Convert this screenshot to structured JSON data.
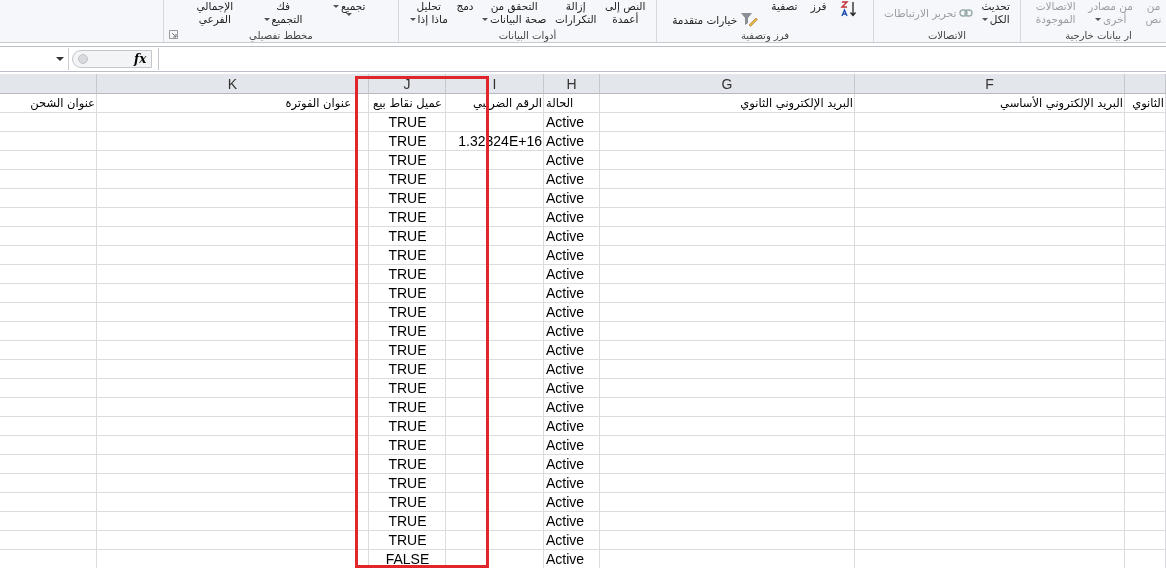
{
  "ribbon": {
    "groups": [
      {
        "label": "ار بيانات خارجية",
        "buttons": [
          {
            "kind": "large",
            "lines": [
              "من",
              "نص"
            ],
            "disabled": true,
            "dropdown": false
          },
          {
            "kind": "large",
            "lines": [
              "من مصادر",
              "أخرى"
            ],
            "disabled": true,
            "dropdown": true
          },
          {
            "kind": "large",
            "lines": [
              "الاتصالات",
              "الموجودة"
            ],
            "disabled": true,
            "dropdown": false
          }
        ]
      },
      {
        "label": "الاتصالات",
        "buttons": [
          {
            "kind": "large",
            "lines": [
              "تحديث",
              "الكل"
            ],
            "disabled": false,
            "dropdown": true
          },
          {
            "kind": "small",
            "lines": [
              "تحرير الارتباطات"
            ],
            "disabled": true,
            "dropdown": false
          }
        ]
      },
      {
        "label": "فرز وتصفية",
        "buttons": [
          {
            "kind": "icon"
          },
          {
            "kind": "large",
            "lines": [
              "فرز"
            ],
            "disabled": false,
            "dropdown": false
          },
          {
            "kind": "large",
            "lines": [
              "تصفية"
            ],
            "disabled": false,
            "dropdown": false
          },
          {
            "kind": "small",
            "lines": [
              "خيارات متقدمة"
            ],
            "disabled": false,
            "dropdown": false
          }
        ]
      },
      {
        "label": "أدوات البيانات",
        "buttons": [
          {
            "kind": "large",
            "lines": [
              "النص إلى",
              "أعمدة"
            ],
            "disabled": false,
            "dropdown": false
          },
          {
            "kind": "large",
            "lines": [
              "إزالة",
              "التكرارات"
            ],
            "disabled": false,
            "dropdown": false
          },
          {
            "kind": "large",
            "lines": [
              "التحقق من",
              "صحة البيانات"
            ],
            "disabled": false,
            "dropdown": true
          },
          {
            "kind": "large",
            "lines": [
              "دمج"
            ],
            "disabled": false,
            "dropdown": false
          },
          {
            "kind": "large",
            "lines": [
              "تحليل",
              "ماذا إذا"
            ],
            "disabled": false,
            "dropdown": true
          }
        ]
      },
      {
        "label": "مخطط تفصيلي",
        "buttons": [
          {
            "kind": "large",
            "lines": [
              "تجميع"
            ],
            "disabled": false,
            "dropdown": true
          },
          {
            "kind": "large",
            "lines": [
              "فك",
              "التجميع"
            ],
            "disabled": false,
            "dropdown": true
          },
          {
            "kind": "large",
            "lines": [
              "الإجمالي",
              "الفرعي"
            ],
            "disabled": false,
            "dropdown": false
          }
        ]
      }
    ]
  },
  "formula_bar": {
    "function_label": "fx"
  },
  "column_headers": [
    {
      "letter": "F"
    },
    {
      "letter": "G"
    },
    {
      "letter": "H"
    },
    {
      "letter": "I"
    },
    {
      "letter": "J"
    },
    {
      "letter": "K"
    }
  ],
  "rows": [
    {
      "column_1": "الثانوي",
      "column_2": "البريد الإلكتروني الأساسي",
      "column_3": "البريد الإلكتروني الثانوي",
      "column_4": "الحالة",
      "column_5": "الرقم الضريبي",
      "column_6": "عميل نقاط بيع",
      "column_7": "عنوان الفوترة",
      "column_8": "عنوان الشحن"
    },
    {
      "column_4": "Active",
      "column_6": "TRUE"
    },
    {
      "column_4": "Active",
      "column_5": "1.32324E+16",
      "column_6": "TRUE"
    },
    {
      "column_4": "Active",
      "column_6": "TRUE"
    },
    {
      "column_4": "Active",
      "column_6": "TRUE"
    },
    {
      "column_4": "Active",
      "column_6": "TRUE"
    },
    {
      "column_4": "Active",
      "column_6": "TRUE"
    },
    {
      "column_4": "Active",
      "column_6": "TRUE"
    },
    {
      "column_4": "Active",
      "column_6": "TRUE"
    },
    {
      "column_4": "Active",
      "column_6": "TRUE"
    },
    {
      "column_4": "Active",
      "column_6": "TRUE"
    },
    {
      "column_4": "Active",
      "column_6": "TRUE"
    },
    {
      "column_4": "Active",
      "column_6": "TRUE"
    },
    {
      "column_4": "Active",
      "column_6": "TRUE"
    },
    {
      "column_4": "Active",
      "column_6": "TRUE"
    },
    {
      "column_4": "Active",
      "column_6": "TRUE"
    },
    {
      "column_4": "Active",
      "column_6": "TRUE"
    },
    {
      "column_4": "Active",
      "column_6": "TRUE"
    },
    {
      "column_4": "Active",
      "column_6": "TRUE"
    },
    {
      "column_4": "Active",
      "column_6": "TRUE"
    },
    {
      "column_4": "Active",
      "column_6": "TRUE"
    },
    {
      "column_4": "Active",
      "column_6": "TRUE"
    },
    {
      "column_4": "Active",
      "column_6": "TRUE"
    },
    {
      "column_4": "Active",
      "column_6": "TRUE"
    },
    {
      "column_4": "Active",
      "column_6": "FALSE"
    }
  ]
}
